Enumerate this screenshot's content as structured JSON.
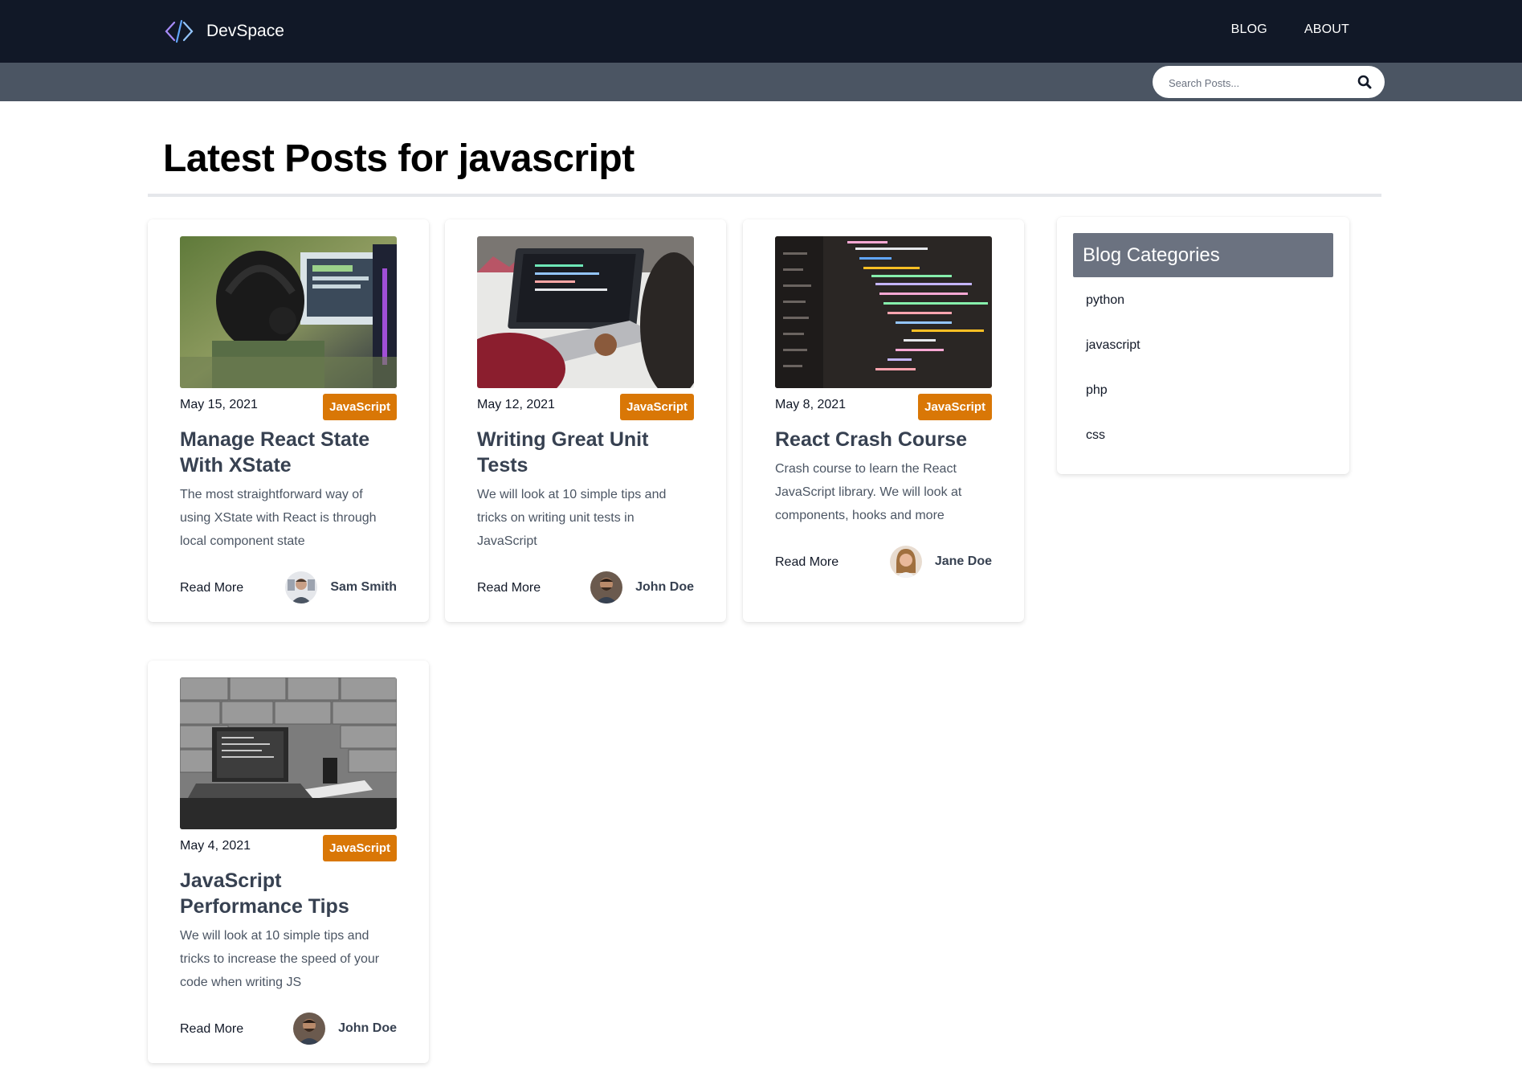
{
  "header": {
    "brand": "DevSpace",
    "nav": [
      "BLOG",
      "ABOUT"
    ]
  },
  "search": {
    "placeholder": "Search Posts...",
    "value": ""
  },
  "main": {
    "title": "Latest Posts for javascript"
  },
  "posts": [
    {
      "date": "May 15, 2021",
      "category": "JavaScript",
      "title": "Manage React State With XState",
      "excerpt": "The most straightforward way of using XState with React is through local component state",
      "read_more": "Read More",
      "author": "Sam Smith",
      "image": "developer-with-headphones-photo"
    },
    {
      "date": "May 12, 2021",
      "category": "JavaScript",
      "title": "Writing Great Unit Tests",
      "excerpt": "We will look at 10 simple tips and tricks on writing unit tests in JavaScript",
      "read_more": "Read More",
      "author": "John Doe",
      "image": "laptop-coding-photo"
    },
    {
      "date": "May 8, 2021",
      "category": "JavaScript",
      "title": "React Crash Course",
      "excerpt": "Crash course to learn the React JavaScript library. We will look at components, hooks and more",
      "read_more": "Read More",
      "author": "Jane Doe",
      "image": "code-editor-photo"
    },
    {
      "date": "May 4, 2021",
      "category": "JavaScript",
      "title": "JavaScript Performance Tips",
      "excerpt": "We will look at 10 simple tips and tricks to increase the speed of your code when writing JS",
      "read_more": "Read More",
      "author": "John Doe",
      "image": "laptop-on-desk-bw-photo"
    }
  ],
  "sidebar": {
    "title": "Blog Categories",
    "categories": [
      "python",
      "javascript",
      "php",
      "css"
    ]
  },
  "colors": {
    "header_bg": "#111827",
    "search_strip_bg": "#4b5563",
    "badge_bg": "#d97706",
    "sidebar_head_bg": "#6b7280"
  }
}
